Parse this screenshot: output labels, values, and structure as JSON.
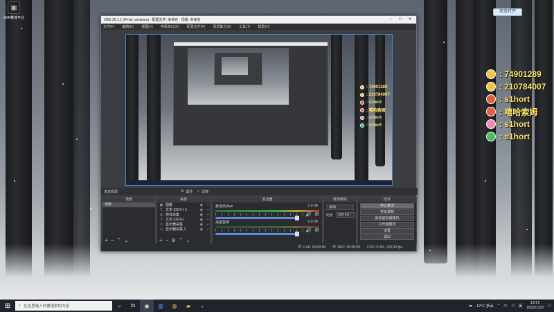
{
  "desktop": {
    "icon_label": "SKR推流平台",
    "top_badge": "双击打开",
    "overlay": [
      {
        "icon": "qq-icon",
        "text": ": 74901289",
        "color": "#f5c542"
      },
      {
        "icon": "wechat-id-icon",
        "text": ": 210784007",
        "color": "#f5c542"
      },
      {
        "icon": "douyu-icon",
        "text": ": s1hort",
        "color": "#e0603a"
      },
      {
        "icon": "weibo-icon",
        "text": ": 嘻哈索姆",
        "color": "#e0603a"
      },
      {
        "icon": "bilibili-icon",
        "text": ": s1hort",
        "color": "#f08ab0"
      },
      {
        "icon": "wechat-icon",
        "text": ": s1hort",
        "color": "#43c25a"
      }
    ]
  },
  "obs": {
    "title": "OBS 26.1.1 (64-bit, windows) - 配置文件: 未命名 - 场景: 未命名",
    "menu": [
      "文件(F)",
      "编辑(E)",
      "视图(V)",
      "停靠窗口(D)",
      "配置文件(P)",
      "场景集合(S)",
      "工具(T)",
      "帮助(H)"
    ],
    "preview_overlay": [
      ": 74901289",
      ": 210784007",
      ": s1hort",
      ": 嘻哈索姆",
      ": s1hort",
      ": s1hort"
    ],
    "controls_row": {
      "label": "未选择源",
      "properties": "属性",
      "filters": "滤镜"
    },
    "docks": {
      "scenes": {
        "title": "场景",
        "items": [
          "场景"
        ]
      },
      "sources": {
        "title": "来源",
        "items": [
          {
            "icon": "image-icon",
            "label": "图像"
          },
          {
            "icon": "text-icon",
            "label": "文本 (GDI+) 3"
          },
          {
            "icon": "game-capture-icon",
            "label": "游戏采集"
          },
          {
            "icon": "text-icon",
            "label": "文本 (GDI+)"
          },
          {
            "icon": "display-capture-icon",
            "label": "显示器采集"
          },
          {
            "icon": "display-capture-icon",
            "label": "显示器采集 2"
          }
        ]
      },
      "mixer": {
        "title": "混音器",
        "channels": [
          {
            "name": "麦克风/Aux",
            "db": "0.0 dB"
          },
          {
            "name": "桌面音频",
            "db": "0.0 dB"
          }
        ]
      },
      "transitions": {
        "title": "转场特效",
        "value": "淡出",
        "duration_label": "时长",
        "duration": "300 ms"
      },
      "controls": {
        "title": "控件",
        "buttons": [
          "停止推流",
          "开始录制",
          "启动虚拟摄像机",
          "工作室模式",
          "设置",
          "退出"
        ]
      }
    },
    "status": {
      "live": "LIVE: 00:00:00",
      "rec": "REC: 00:00:00",
      "cpu": "CPU: 0.5%, 120.00 fps"
    }
  },
  "taskbar": {
    "search_placeholder": "在这里输入你要搜索的内容",
    "weather": "12°C 多云",
    "lang": "英",
    "time": "19:21",
    "date": "2021/12/5"
  }
}
